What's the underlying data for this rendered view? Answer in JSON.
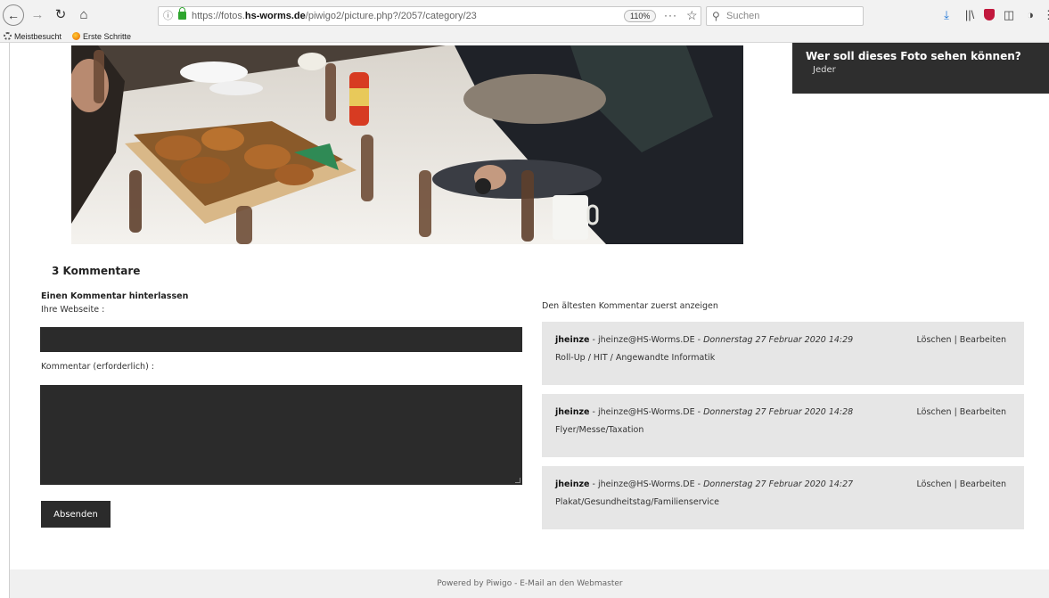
{
  "browser": {
    "url_prefix": "https://fotos.",
    "url_domain": "hs-worms.de",
    "url_path": "/piwigo2/picture.php?/2057/category/23",
    "zoom": "110%",
    "more": "···",
    "search_placeholder": "Suchen",
    "bookmarks": [
      "Meistbesucht",
      "Erste Schritte"
    ]
  },
  "privacy": {
    "title": "Wer soll dieses Foto sehen können?",
    "value": "Jeder"
  },
  "comments": {
    "count_label": "3 Kommentare",
    "form_title": "Einen Kommentar hinterlassen",
    "website_label": "Ihre Webseite :",
    "website_value": "",
    "comment_label": "Kommentar (erforderlich) :",
    "comment_value": "",
    "submit_label": "Absenden",
    "sort_label": "Den ältesten Kommentar zuerst anzeigen",
    "items": [
      {
        "author": "jheinze",
        "email": "jheinze@HS-Worms.DE",
        "date": "Donnerstag 27 Februar 2020 14:29",
        "text": "Roll-Up / HIT / Angewandte Informatik",
        "delete": "Löschen",
        "edit": "Bearbeiten"
      },
      {
        "author": "jheinze",
        "email": "jheinze@HS-Worms.DE",
        "date": "Donnerstag 27 Februar 2020 14:28",
        "text": "Flyer/Messe/Taxation",
        "delete": "Löschen",
        "edit": "Bearbeiten"
      },
      {
        "author": "jheinze",
        "email": "jheinze@HS-Worms.DE",
        "date": "Donnerstag 27 Februar 2020 14:27",
        "text": "Plakat/Gesundheitstag/Familienservice",
        "delete": "Löschen",
        "edit": "Bearbeiten"
      }
    ]
  },
  "footer": {
    "powered_by": "Powered by",
    "piwigo": "Piwigo",
    "separator": " - ",
    "contact": "E-Mail an den Webmaster"
  }
}
